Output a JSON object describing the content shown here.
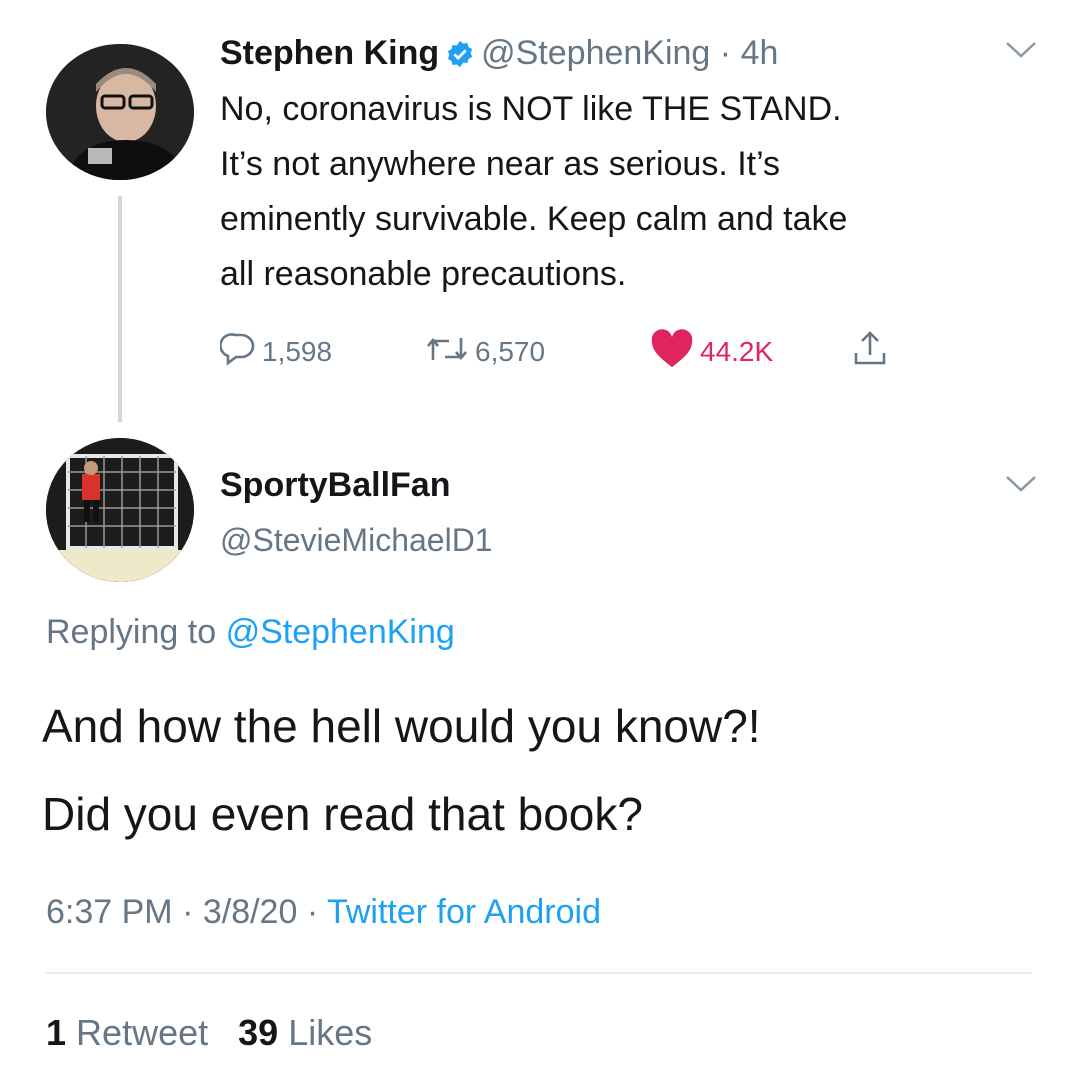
{
  "parent_tweet": {
    "author_name": "Stephen King",
    "author_handle": "@StephenKing",
    "time_ago": "4h",
    "text_lines": [
      "No, coronavirus is NOT like THE STAND.",
      "It’s not anywhere near as serious. It’s",
      "eminently survivable. Keep calm and take",
      "all reasonable precautions."
    ],
    "replies": "1,598",
    "retweets": "6,570",
    "likes": "44.2K"
  },
  "reply_tweet": {
    "author_name": "SportyBallFan",
    "author_handle": "@StevieMichaelD1",
    "replying_label": "Replying to",
    "replying_to": "@StephenKing",
    "text_lines": [
      "And how the hell would you know?!",
      "Did you even read that book?"
    ],
    "time": "6:37 PM",
    "date": "3/8/20",
    "source": "Twitter for Android",
    "retweet_count": "1",
    "retweet_label": "Retweet",
    "like_count": "39",
    "like_label": "Likes"
  },
  "icons": {
    "verified": "verified-badge-icon",
    "reply": "reply-icon",
    "retweet": "retweet-icon",
    "like": "heart-icon",
    "share": "share-icon",
    "menu": "chevron-down-icon"
  },
  "colors": {
    "accent": "#1da1f2",
    "like": "#e0245e",
    "secondary_text": "#657786"
  }
}
